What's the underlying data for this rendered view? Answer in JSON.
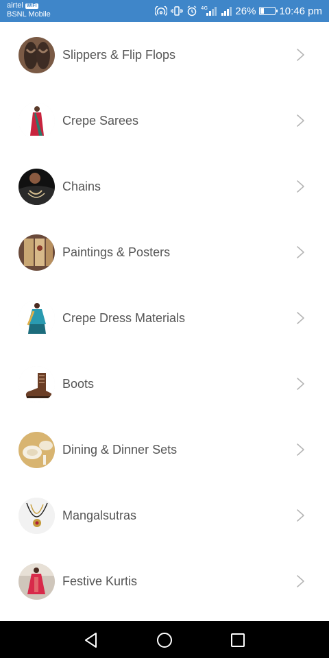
{
  "status_bar": {
    "carrier_top": "airtel",
    "wifi_badge": "WiFi",
    "carrier_bottom": "BSNL Mobile",
    "network_label": "4G",
    "battery_text": "26%",
    "battery_level": 0.26,
    "time": "10:46 pm",
    "icons": [
      "hotspot-icon",
      "vibrate-icon",
      "alarm-icon",
      "signal-4g-icon",
      "signal-icon",
      "battery-icon"
    ]
  },
  "categories": [
    {
      "label": "Slippers & Flip Flops",
      "thumb": "slippers-thumbnail"
    },
    {
      "label": "Crepe Sarees",
      "thumb": "saree-thumbnail"
    },
    {
      "label": "Chains",
      "thumb": "chains-thumbnail"
    },
    {
      "label": "Paintings & Posters",
      "thumb": "paintings-thumbnail"
    },
    {
      "label": "Crepe Dress Materials",
      "thumb": "dress-material-thumbnail"
    },
    {
      "label": "Boots",
      "thumb": "boots-thumbnail"
    },
    {
      "label": "Dining & Dinner Sets",
      "thumb": "dining-thumbnail"
    },
    {
      "label": "Mangalsutras",
      "thumb": "mangalsutra-thumbnail"
    },
    {
      "label": "Festive Kurtis",
      "thumb": "kurtis-thumbnail"
    }
  ],
  "nav_bar": {
    "buttons": [
      "back-icon",
      "home-icon",
      "recents-icon"
    ]
  },
  "colors": {
    "status_bar": "#3f86c9",
    "label_text": "#555555",
    "chevron": "#b5b5b5",
    "nav_bar": "#000000"
  }
}
